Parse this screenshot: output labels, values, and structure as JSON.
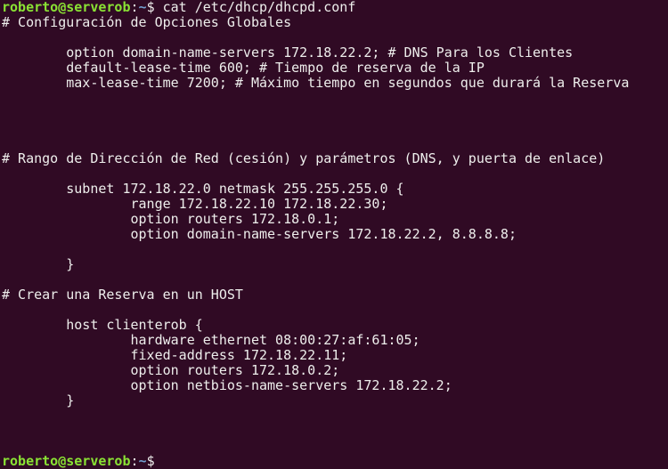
{
  "colors": {
    "background": "#300a24",
    "text": "#eeeeec",
    "user_host": "#8ae234",
    "path": "#729fcf"
  },
  "prompt": {
    "user_host": "roberto@serverob",
    "path": "~",
    "symbol": "$"
  },
  "command": " cat /etc/dhcp/dhcpd.conf",
  "output": [
    "# Configuración de Opciones Globales",
    "",
    "        option domain-name-servers 172.18.22.2; # DNS Para los Clientes",
    "        default-lease-time 600; # Tiempo de reserva de la IP",
    "        max-lease-time 7200; # Máximo tiempo en segundos que durará la Reserva",
    "",
    "",
    "",
    "",
    "# Rango de Dirección de Red (cesión) y parámetros (DNS, y puerta de enlace)",
    "",
    "        subnet 172.18.22.0 netmask 255.255.255.0 {",
    "                range 172.18.22.10 172.18.22.30;",
    "                option routers 172.18.0.1;",
    "                option domain-name-servers 172.18.22.2, 8.8.8.8;",
    "",
    "        }",
    "",
    "# Crear una Reserva en un HOST",
    "",
    "        host clienterob {",
    "                hardware ethernet 08:00:27:af:61:05;",
    "                fixed-address 172.18.22.11;",
    "                option routers 172.18.0.2;",
    "                option netbios-name-servers 172.18.22.2;",
    "        }",
    "",
    "",
    ""
  ]
}
